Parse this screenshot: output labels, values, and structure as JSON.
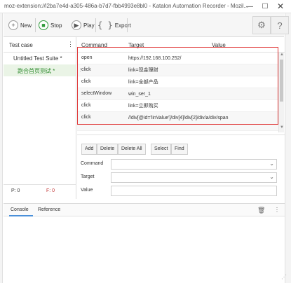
{
  "window": {
    "title": "moz-extension://l2ba7e4d-a305-486a-b7d7-fbb4993e8bl0 - Katalon Automation Recorder - Mozil...",
    "minimize": "—",
    "maximize": "☐",
    "close": "✕"
  },
  "toolbar": {
    "new_label": "New",
    "stop_label": "Stop",
    "play_label": "Play",
    "export_label": "Export",
    "settings_icon": "gear-icon",
    "help_icon": "help-icon"
  },
  "test_case_panel": {
    "header": "Test case",
    "suite_name": "Untitled Test Suite *",
    "case_name": "跑合首页测试 *",
    "pass_count": "P: 0",
    "fail_count": "F: 0"
  },
  "table": {
    "columns": [
      "Command",
      "Target",
      "Value"
    ],
    "rows": [
      {
        "command": "open",
        "target": "https://192.168.100.252/",
        "value": ""
      },
      {
        "command": "click",
        "target": "link=现金理财",
        "value": ""
      },
      {
        "command": "click",
        "target": "link=全部产品",
        "value": ""
      },
      {
        "command": "selectWindow",
        "target": "win_ser_1",
        "value": ""
      },
      {
        "command": "click",
        "target": "link=立即购买",
        "value": ""
      },
      {
        "command": "click",
        "target": "//div[@id='linValue']/div[4]/div[2]/div/a/div/span",
        "value": ""
      }
    ]
  },
  "editor": {
    "add_label": "Add",
    "delete_label": "Delete",
    "delete_all_label": "Delete All",
    "select_label": "Select",
    "find_label": "Find",
    "command_label": "Command",
    "target_label": "Target",
    "value_label": "Value",
    "command_value": "",
    "target_value": "",
    "value_value": ""
  },
  "bottom": {
    "console_tab": "Console",
    "reference_tab": "Reference"
  },
  "colors": {
    "accent_green": "#2e8b2e",
    "highlight_red": "#e03a3a",
    "tab_blue": "#4a90d9"
  }
}
